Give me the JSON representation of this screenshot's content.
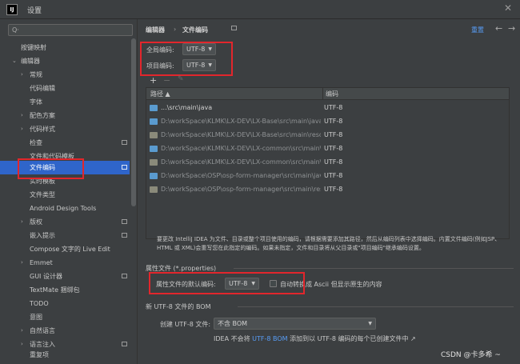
{
  "window": {
    "icon_text": "IJ",
    "title": "设置"
  },
  "sidebar": {
    "search_placeholder": "Q·",
    "items": [
      {
        "label": "按键映射"
      },
      {
        "label": "编辑器"
      },
      {
        "label": "常规"
      },
      {
        "label": "代码编辑"
      },
      {
        "label": "字体"
      },
      {
        "label": "配色方案"
      },
      {
        "label": "代码样式"
      },
      {
        "label": "检查"
      },
      {
        "label": "文件和代码模板"
      },
      {
        "label": "文件编码"
      },
      {
        "label": "实时模板"
      },
      {
        "label": "文件类型"
      },
      {
        "label": "Android Design Tools"
      },
      {
        "label": "版权"
      },
      {
        "label": "嵌入提示"
      },
      {
        "label": "Compose 文字的 Live Edit"
      },
      {
        "label": "Emmet"
      },
      {
        "label": "GUI 设计器"
      },
      {
        "label": "TextMate 捆绑包"
      },
      {
        "label": "TODO"
      },
      {
        "label": "意图"
      },
      {
        "label": "自然语言"
      },
      {
        "label": "语言注入"
      },
      {
        "label": "重复项"
      }
    ]
  },
  "header": {
    "breadcrumb_1": "编辑器",
    "breadcrumb_sep": "›",
    "breadcrumb_2": "文件编码",
    "reset": "重置",
    "back": "←",
    "forward": "→"
  },
  "encoding": {
    "global_label": "全局编码:",
    "global_value": "UTF-8",
    "project_label": "项目编码:",
    "project_value": "UTF-8"
  },
  "toolbar": {
    "add": "+",
    "remove": "−",
    "edit": "✎"
  },
  "table": {
    "col_path": "路径 ▲",
    "col_encoding": "编码",
    "rows": [
      {
        "path": "...\\src\\main\\java",
        "encoding": "UTF-8"
      },
      {
        "path": "D:\\workSpace\\KLMK\\LX-DEV\\LX-Base\\src\\main\\java",
        "encoding": "UTF-8"
      },
      {
        "path": "D:\\workSpace\\KLMK\\LX-DEV\\LX-Base\\src\\main\\resources",
        "encoding": "UTF-8"
      },
      {
        "path": "D:\\workSpace\\KLMK\\LX-DEV\\LX-common\\src\\main\\java",
        "encoding": "UTF-8"
      },
      {
        "path": "D:\\workSpace\\KLMK\\LX-DEV\\LX-common\\src\\main\\resources",
        "encoding": "UTF-8"
      },
      {
        "path": "D:\\workSpace\\OSP\\osp-form-manager\\src\\main\\java",
        "encoding": "UTF-8"
      },
      {
        "path": "D:\\workSpace\\OSP\\osp-form-manager\\src\\main\\resources",
        "encoding": "UTF-8"
      }
    ]
  },
  "description": {
    "line1": "要更改 IntelliJ IDEA 为文件、目录或整个项目使用的编码，请根据需要添加其路径，然后从编码列表中选择编码。内置文件编码(例如JSP、",
    "line2": "HTML 或 XML)会重写您在此指定的编码。如果未指定，文件和目录将从父目录或\"项目编码\"继承编码设置。"
  },
  "properties": {
    "section_title": "属性文件 (*.properties)",
    "default_label": "属性文件的默认编码:",
    "default_value": "UTF-8",
    "ascii_label": "自动转换成 Ascii 但显示原生的内容"
  },
  "bom": {
    "section_title": "新 UTF-8 文件的 BOM",
    "create_label": "创建 UTF-8 文件:",
    "create_value": "不含 BOM",
    "note_prefix": "IDEA 不会将",
    "note_link": "UTF-8 BOM",
    "note_suffix": "添加到以 UTF-8 编码的每个已创建文件中 ↗"
  },
  "watermark": "CSDN @卡多希 ~"
}
